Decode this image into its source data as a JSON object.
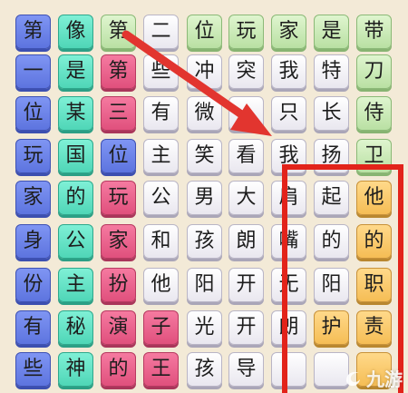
{
  "grid": {
    "rows": [
      [
        "第",
        "像",
        "第",
        "二",
        "位",
        "玩",
        "家",
        "是",
        "带"
      ],
      [
        "一",
        "是",
        "第",
        "些",
        "冲",
        "突",
        "我",
        "特",
        "刀"
      ],
      [
        "位",
        "某",
        "三",
        "有",
        "微",
        "",
        "只",
        "长",
        "侍"
      ],
      [
        "玩",
        "国",
        "位",
        "主",
        "笑",
        "看",
        "我",
        "扬",
        "卫"
      ],
      [
        "家",
        "的",
        "玩",
        "公",
        "男",
        "大",
        "肩",
        "起",
        "他"
      ],
      [
        "身",
        "公",
        "家",
        "和",
        "孩",
        "朗",
        "嘴",
        "的",
        "的"
      ],
      [
        "份",
        "主",
        "扮",
        "他",
        "阳",
        "开",
        "无",
        "阳",
        "职"
      ],
      [
        "有",
        "秘",
        "演",
        "子",
        "光",
        "开",
        "朗",
        "护",
        "责"
      ],
      [
        "些",
        "神",
        "的",
        "王",
        "孩",
        "导",
        "",
        "",
        ""
      ]
    ],
    "colors": [
      [
        "blue",
        "teal",
        "green",
        "white",
        "green",
        "green",
        "green",
        "green",
        "green"
      ],
      [
        "blue",
        "teal",
        "pink",
        "white",
        "white",
        "white",
        "white",
        "white",
        "green"
      ],
      [
        "blue",
        "teal",
        "pink",
        "white",
        "white",
        "white",
        "white",
        "white",
        "green"
      ],
      [
        "blue",
        "teal",
        "blue",
        "white",
        "white",
        "white",
        "white",
        "white",
        "green"
      ],
      [
        "blue",
        "teal",
        "pink",
        "white",
        "white",
        "white",
        "white",
        "white",
        "orange"
      ],
      [
        "blue",
        "teal",
        "pink",
        "white",
        "white",
        "white",
        "white",
        "white",
        "orange"
      ],
      [
        "blue",
        "teal",
        "pink",
        "white",
        "white",
        "white",
        "white",
        "white",
        "orange"
      ],
      [
        "blue",
        "teal",
        "pink",
        "pink",
        "white",
        "white",
        "white",
        "orange",
        "orange"
      ],
      [
        "blue",
        "teal",
        "pink",
        "pink",
        "white",
        "white",
        "white",
        "white",
        "orange"
      ]
    ]
  },
  "palette": {
    "arrow": "#e2352f",
    "highlight_box": "#e2231a"
  },
  "watermark": {
    "icon": "swirl-logo-icon",
    "text": "九游"
  }
}
